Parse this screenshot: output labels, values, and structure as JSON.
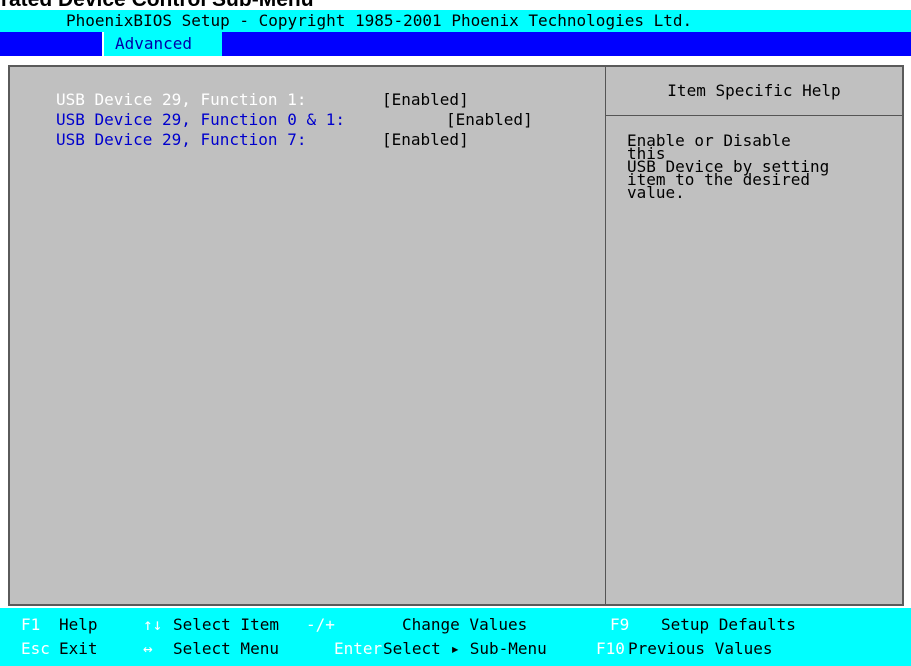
{
  "document_heading": "grated Device Control Sub-Menu",
  "title_bar": "PhoenixBIOS Setup - Copyright 1985-2001 Phoenix Technologies Ltd.",
  "menu": {
    "active_tab": "Advanced"
  },
  "settings": [
    {
      "label": "USB Device 29, Function 1:",
      "value": "[Enabled]",
      "selected": true
    },
    {
      "label": "USB Device 29, Function 0 & 1:",
      "value": "[Enabled]",
      "selected": false
    },
    {
      "label": "USB Device 29, Function 7:",
      "value": "[Enabled]",
      "selected": false
    }
  ],
  "help": {
    "title": "Item Specific Help",
    "text": "Enable or Disable\nthis\nUSB Device by setting\nitem to the desired\nvalue."
  },
  "status_bar": {
    "row1": [
      {
        "key": "F1",
        "desc": "Help"
      },
      {
        "key": "↑↓",
        "desc": "Select Item"
      },
      {
        "key": "-/+",
        "desc": "Change Values"
      },
      {
        "key": "F9",
        "desc": "Setup Defaults"
      }
    ],
    "row2": [
      {
        "key": "Esc",
        "desc": "Exit"
      },
      {
        "key": "↔",
        "desc": "Select Menu"
      },
      {
        "key": "Enter",
        "desc": "Select ▸ Sub-Menu"
      },
      {
        "key": "F10",
        "desc": "Previous Values"
      }
    ]
  },
  "colors": {
    "title_bar": "#00ffff",
    "menu_bar": "#0000ff",
    "panel": "#c0c0c0",
    "setting_label": "#0000cc",
    "selected_label": "#ffffff",
    "status_key": "#ffffff"
  }
}
